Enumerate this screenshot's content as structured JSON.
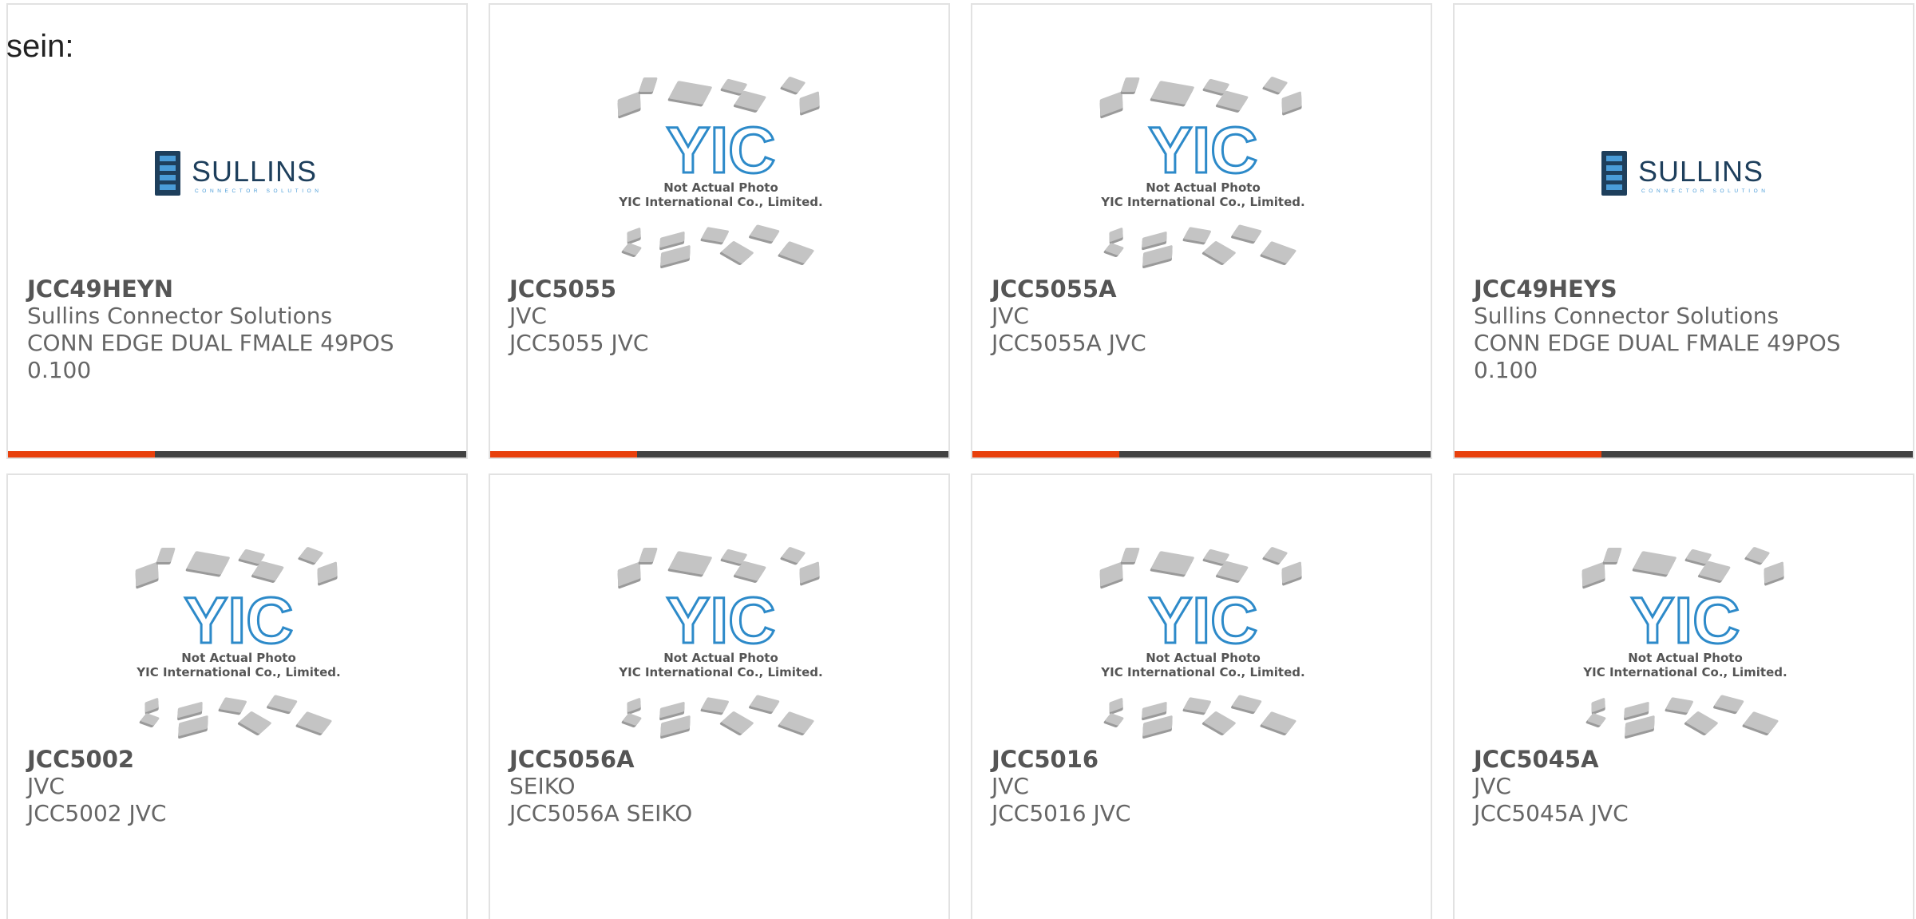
{
  "intro_text": "sein:",
  "colors": {
    "accent": "#e8400c",
    "bar_track": "#424242",
    "card_border": "#e2e2e2",
    "sullins_dark": "#1e3f5c",
    "sullins_light": "#4a9cd8",
    "yic_blue": "#2d8ac9"
  },
  "placeholder": {
    "caption_line1": "Not Actual Photo",
    "caption_line2": "YIC International Co., Limited.",
    "logo_text": "YIC"
  },
  "sullins_logo": {
    "word": "SULLINS",
    "tagline": "CONNECTOR SOLUTIONS"
  },
  "products": [
    {
      "part": "JCC49HEYN",
      "manufacturer": "Sullins Connector Solutions",
      "description_line1": "CONN EDGE DUAL FMALE 49POS",
      "description_line2": "0.100",
      "image": "sullins-logo",
      "progress": 0.32
    },
    {
      "part": "JCC5055",
      "manufacturer": "JVC",
      "description_line1": "JCC5055 JVC",
      "description_line2": "",
      "image": "yic-placeholder",
      "progress": 0.32
    },
    {
      "part": "JCC5055A",
      "manufacturer": "JVC",
      "description_line1": "JCC5055A JVC",
      "description_line2": "",
      "image": "yic-placeholder",
      "progress": 0.32
    },
    {
      "part": "JCC49HEYS",
      "manufacturer": "Sullins Connector Solutions",
      "description_line1": "CONN EDGE DUAL FMALE 49POS",
      "description_line2": "0.100",
      "image": "sullins-logo",
      "progress": 0.32
    },
    {
      "part": "JCC5002",
      "manufacturer": "JVC",
      "description_line1": "JCC5002 JVC",
      "description_line2": "",
      "image": "yic-placeholder",
      "progress": null
    },
    {
      "part": "JCC5056A",
      "manufacturer": "SEIKO",
      "description_line1": "JCC5056A SEIKO",
      "description_line2": "",
      "image": "yic-placeholder",
      "progress": null
    },
    {
      "part": "JCC5016",
      "manufacturer": "JVC",
      "description_line1": "JCC5016 JVC",
      "description_line2": "",
      "image": "yic-placeholder",
      "progress": null
    },
    {
      "part": "JCC5045A",
      "manufacturer": "JVC",
      "description_line1": "JCC5045A JVC",
      "description_line2": "",
      "image": "yic-placeholder",
      "progress": null
    }
  ]
}
